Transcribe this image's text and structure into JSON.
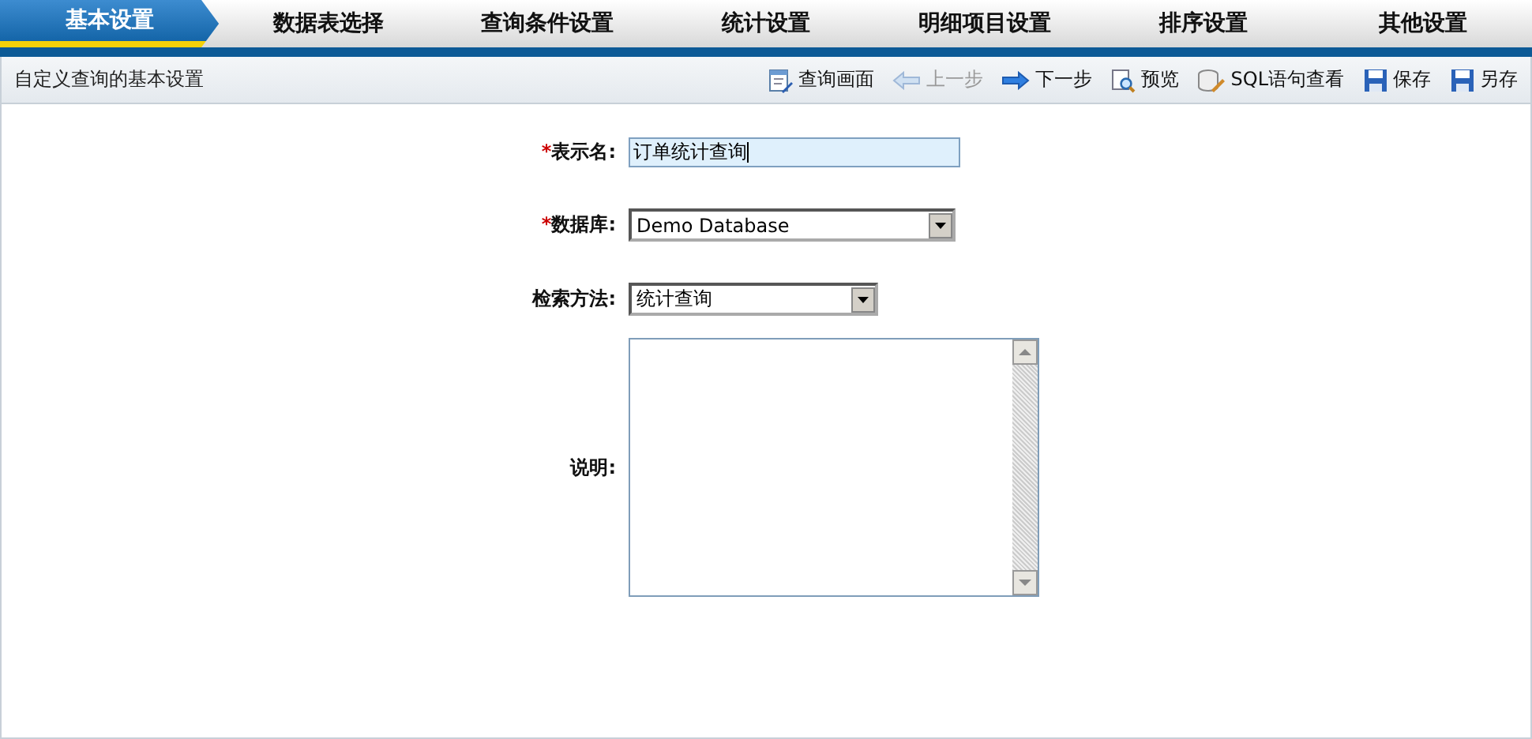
{
  "tabs": [
    {
      "label": "基本设置",
      "selected": true
    },
    {
      "label": "数据表选择",
      "selected": false
    },
    {
      "label": "查询条件设置",
      "selected": false
    },
    {
      "label": "统计设置",
      "selected": false
    },
    {
      "label": "明细项目设置",
      "selected": false
    },
    {
      "label": "排序设置",
      "selected": false
    },
    {
      "label": "其他设置",
      "selected": false
    }
  ],
  "toolbar": {
    "title": "自定义查询的基本设置",
    "buttons": [
      {
        "label": "查询画面",
        "kind": "screen",
        "disabled": false
      },
      {
        "label": "上一步",
        "kind": "back",
        "disabled": true
      },
      {
        "label": "下一步",
        "kind": "next",
        "disabled": false
      },
      {
        "label": "预览",
        "kind": "preview",
        "disabled": false
      },
      {
        "label": "SQL语句查看",
        "kind": "sql",
        "disabled": false
      },
      {
        "label": "保存",
        "kind": "save",
        "disabled": false
      },
      {
        "label": "另存",
        "kind": "save",
        "disabled": false
      }
    ]
  },
  "form": [
    {
      "label": "表示名:",
      "kind": "text",
      "required_mark": "*",
      "value": "订单统计查询",
      "focused": true
    },
    {
      "label": "数据库:",
      "kind": "select",
      "required_mark": "*",
      "value": "Demo Database"
    },
    {
      "label": "检索方法:",
      "kind": "select",
      "value": "统计查询"
    },
    {
      "label": "说明:",
      "kind": "textarea"
    }
  ]
}
